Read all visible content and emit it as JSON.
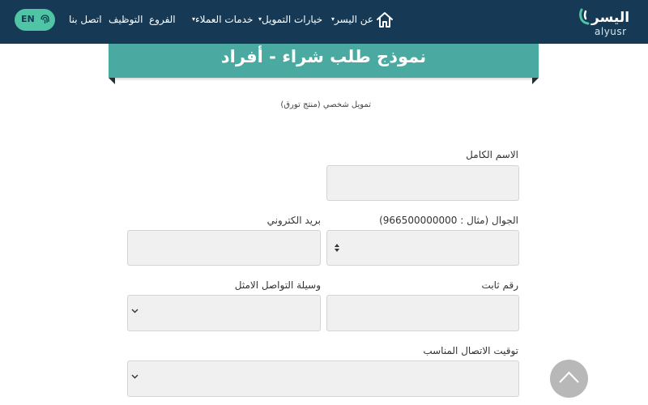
{
  "header": {
    "logo_ar": "اليسر",
    "logo_en": "alyusr",
    "nav": {
      "about": "عن اليسر",
      "financing": "خيارات التمويل",
      "customer_services": "خدمات العملاء",
      "branches": "الفروع",
      "careers": "التوظيف",
      "contact": "اتصل بنا"
    },
    "lang_label": "EN",
    "colors": {
      "bar": "#163a55",
      "lang_pill": "#4fc5a5"
    }
  },
  "banner": {
    "title": "نموذج طلب شراء - أفراد",
    "color": "#4aa9a0"
  },
  "subtitle": "تمويل شخصي (منتج تورق)",
  "form": {
    "full_name_label": "الاسم الكامل",
    "mobile_label": "الجوال (مثال : 966500000000)",
    "email_label": "بريد الكتروني",
    "landline_label": "رقم ثابت",
    "contact_method_label": "وسيلة التواصل الامثل",
    "contact_time_label": "توقيت الاتصال المناسب"
  }
}
